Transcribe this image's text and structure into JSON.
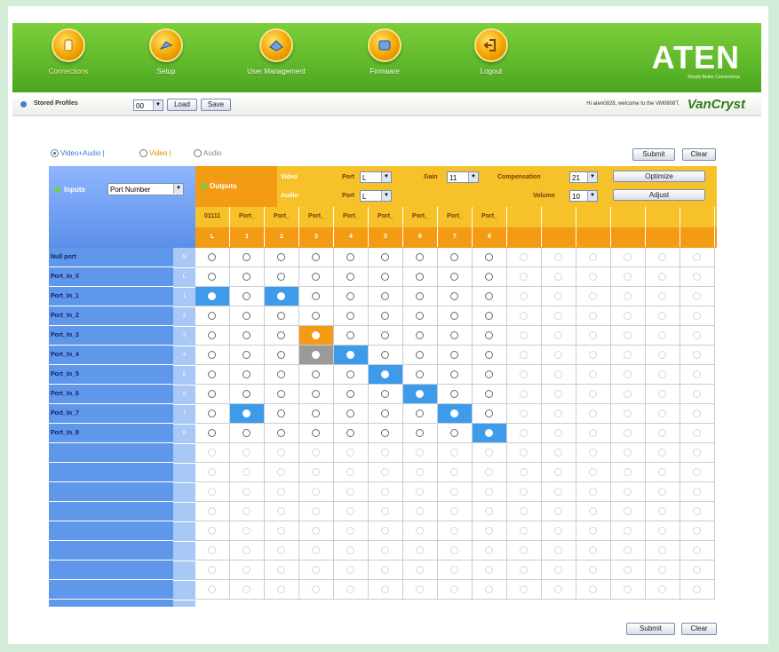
{
  "nav": {
    "items": [
      {
        "label": "Connections",
        "icon": "connections-icon",
        "active": true
      },
      {
        "label": "Setup",
        "icon": "setup-icon",
        "active": false
      },
      {
        "label": "User Management",
        "icon": "user-management-icon",
        "active": false
      },
      {
        "label": "Firmware",
        "icon": "firmware-icon",
        "active": false
      },
      {
        "label": "Logout",
        "icon": "logout-icon",
        "active": false
      }
    ],
    "brand": "ATEN",
    "brand_sub": "Simply Better Connections"
  },
  "profile_bar": {
    "label": "Stored Profiles",
    "profile_value": "00",
    "load_label": "Load",
    "save_label": "Save",
    "welcome": "Hi aten0828, welcome to the VM0808T.",
    "product": "VanCryst"
  },
  "mode": {
    "options": [
      "Video+Audio",
      "Video",
      "Audio"
    ],
    "selected": "Video+Audio"
  },
  "top_buttons": {
    "submit": "Submit",
    "clear": "Clear"
  },
  "bottom_buttons": {
    "submit": "Submit",
    "clear": "Clear"
  },
  "inputs_header": {
    "label": "Inputs",
    "sort_value": "Port Number"
  },
  "outputs_header": {
    "label": "Outputs",
    "video_label": "Video",
    "audio_label": "Audio",
    "video_port_label": "Port",
    "video_port_value": "L",
    "audio_port_label": "Port",
    "audio_port_value": "L",
    "gain_label": "Gain",
    "gain_value": "11",
    "compensation_label": "Compensation",
    "compensation_value": "21",
    "volume_label": "Volume",
    "volume_value": "10",
    "optimize_label": "Optimize",
    "adjust_label": "Adjust"
  },
  "output_names": [
    "01111",
    "Port_",
    "Port_",
    "Port_",
    "Port_",
    "Port_",
    "Port_",
    "Port_",
    "Port_"
  ],
  "output_numbers": [
    "L",
    "1",
    "2",
    "3",
    "4",
    "5",
    "6",
    "7",
    "8"
  ],
  "rows": [
    {
      "name": "Null port",
      "num": "N",
      "sel": -1,
      "style": "none"
    },
    {
      "name": "Port_In_0",
      "num": "L",
      "sel": -1,
      "style": "none"
    },
    {
      "name": "Port_In_1",
      "num": "1",
      "sel": 0,
      "sel2": 2,
      "style": "blue"
    },
    {
      "name": "Port_In_2",
      "num": "2",
      "sel": -1,
      "style": "none"
    },
    {
      "name": "Port_In_3",
      "num": "3",
      "sel": 3,
      "style": "orange"
    },
    {
      "name": "Port_In_4",
      "num": "4",
      "sel": 4,
      "gray": 3,
      "style": "blue"
    },
    {
      "name": "Port_In_5",
      "num": "5",
      "sel": 5,
      "style": "blue"
    },
    {
      "name": "Port_In_6",
      "num": "6",
      "sel": 6,
      "style": "blue"
    },
    {
      "name": "Port_In_7",
      "num": "7",
      "sel": 1,
      "sel2": 7,
      "style": "blue"
    },
    {
      "name": "Port_In_8",
      "num": "8",
      "sel": 8,
      "style": "blue"
    }
  ]
}
